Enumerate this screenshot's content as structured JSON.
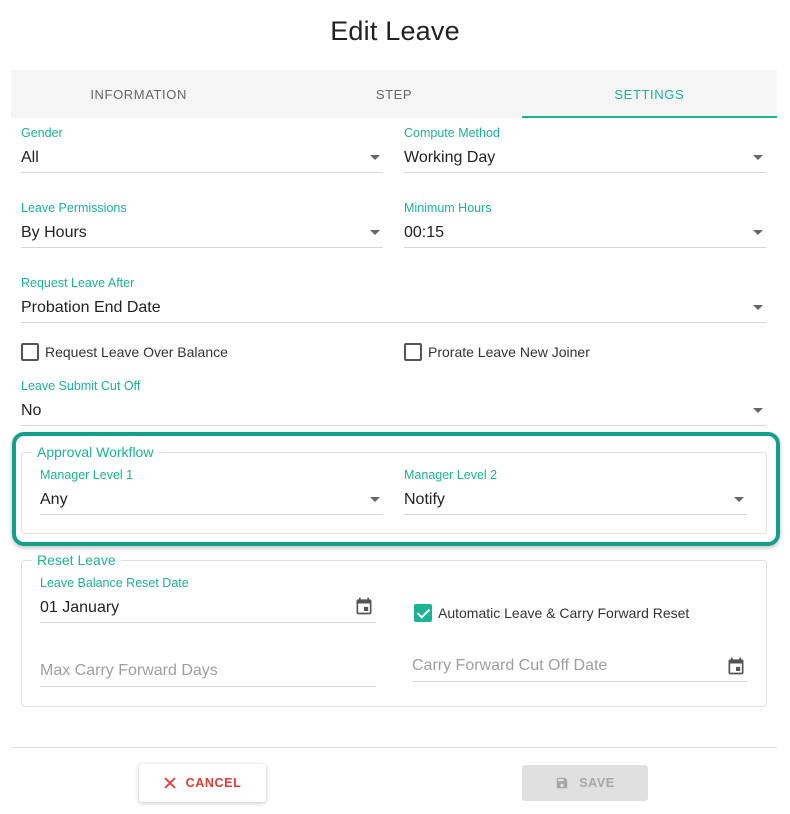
{
  "title": "Edit Leave",
  "tabs": [
    {
      "label": "INFORMATION",
      "active": false
    },
    {
      "label": "STEP",
      "active": false
    },
    {
      "label": "SETTINGS",
      "active": true
    }
  ],
  "fields": {
    "gender": {
      "label": "Gender",
      "value": "All"
    },
    "compute_method": {
      "label": "Compute Method",
      "value": "Working Day"
    },
    "leave_permissions": {
      "label": "Leave Permissions",
      "value": "By Hours"
    },
    "minimum_hours": {
      "label": "Minimum Hours",
      "value": "00:15"
    },
    "request_leave_after": {
      "label": "Request Leave After",
      "value": "Probation End Date"
    },
    "leave_submit_cut_off": {
      "label": "Leave Submit Cut Off",
      "value": "No"
    }
  },
  "checkboxes": {
    "request_over_balance": {
      "label": "Request Leave Over Balance",
      "checked": false
    },
    "prorate_new_joiner": {
      "label": "Prorate Leave New Joiner",
      "checked": false
    }
  },
  "approval": {
    "legend": "Approval Workflow",
    "manager_level_1": {
      "label": "Manager Level 1",
      "value": "Any"
    },
    "manager_level_2": {
      "label": "Manager Level 2",
      "value": "Notify"
    }
  },
  "reset": {
    "legend": "Reset Leave",
    "balance_reset_date": {
      "label": "Leave Balance Reset Date",
      "value": "01 January"
    },
    "auto_reset": {
      "label": "Automatic Leave & Carry Forward Reset",
      "checked": true
    },
    "max_carry_forward_placeholder": "Max Carry Forward Days",
    "carry_forward_cutoff_placeholder": "Carry Forward Cut Off Date"
  },
  "actions": {
    "cancel_label": "CANCEL",
    "save_label": "SAVE"
  },
  "colors": {
    "accent": "#1ab394",
    "highlight_border": "#13a08a",
    "cancel": "#e53935"
  }
}
